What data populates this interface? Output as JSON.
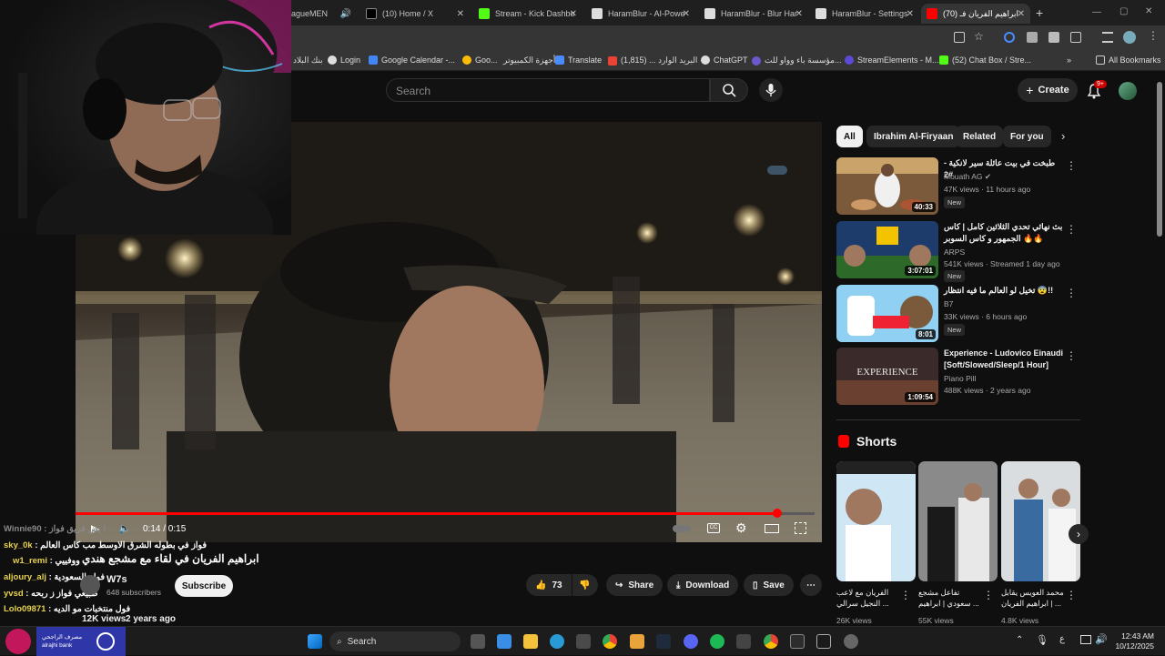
{
  "tabs": [
    {
      "label": "agueMEN"
    },
    {
      "label": "(10) Home / X"
    },
    {
      "label": "Stream - Kick Dashbo"
    },
    {
      "label": "HaramBlur - AI-Powe"
    },
    {
      "label": "HaramBlur - Blur Har"
    },
    {
      "label": "HaramBlur - Settings"
    },
    {
      "label": "(70) ابراهيم الفريان فـ"
    }
  ],
  "bookmarks": [
    {
      "label": "بنك البلاد"
    },
    {
      "label": "Login"
    },
    {
      "label": "Google Calendar -..."
    },
    {
      "label": "Goo..."
    },
    {
      "label": "أجهزة الكمبيوتر"
    },
    {
      "label": "Translate"
    },
    {
      "label": "البريد الوارد ... (1,815)"
    },
    {
      "label": "ChatGPT"
    },
    {
      "label": "مؤسسة باء وواو للت..."
    },
    {
      "label": "StreamElements - M..."
    },
    {
      "label": "(52) Chat Box / Stre..."
    },
    {
      "label": "All Bookmarks"
    }
  ],
  "header": {
    "search_placeholder": "Search",
    "create_label": "Create",
    "notif_count": "9+"
  },
  "player": {
    "time": "0:14 / 0:15",
    "progress": 0.95
  },
  "video": {
    "title": "ابراهيم الفريان في لقاء مع مشجع هندي",
    "channel": "W7s",
    "subscribers": "648 subscribers",
    "subscribe_label": "Subscribe",
    "likes": "73",
    "share_label": "Share",
    "download_label": "Download",
    "save_label": "Save",
    "views": "12K views",
    "age": "2 years ago"
  },
  "chat": [
    {
      "user": "Winnie90",
      "msg": "يض فريق فواز !"
    },
    {
      "user": "sky_0k",
      "msg": "فواز في بطوله الشرق الاوسط مب كاس العالم"
    },
    {
      "user": "w1_remi",
      "msg": "ووفييي"
    },
    {
      "user": "aljoury_alj",
      "msg": "فوله السعودية"
    },
    {
      "user": "yvsd",
      "msg": "طبيعي فواز ز ربحه"
    },
    {
      "user": "Lolo09871",
      "msg": "فول منتخبات مو الديه"
    }
  ],
  "filters": [
    {
      "label": "All"
    },
    {
      "label": "Ibrahim Al-Firyaan"
    },
    {
      "label": "Related"
    },
    {
      "label": "For you"
    }
  ],
  "recommended": [
    {
      "title": "طبخت في بيت عائلة سير لانكية - #2",
      "channel": "Mouath AG",
      "meta": "47K views · 11 hours ago",
      "duration": "40:33",
      "badge": "New"
    },
    {
      "title": "بث نهائي تحدي الثلاثين كامل | كاس الجمهور و كاس السوبر 🔥🔥",
      "channel": "ARPS",
      "meta": "541K views · Streamed 1 day ago",
      "duration": "3:07:01",
      "badge": "New"
    },
    {
      "title": "تخيل لو العالم ما فيه انتظار 😨!!",
      "channel": "B7",
      "meta": "33K views · 6 hours ago",
      "duration": "8:01",
      "badge": "New"
    },
    {
      "title": "Experience - Ludovico Einaudi [Soft/Slowed/Sleep/1 Hour]",
      "channel": "Piano Pill",
      "meta": "488K views · 2 years ago",
      "duration": "1:09:54",
      "badge": ""
    }
  ],
  "shorts": {
    "heading": "Shorts",
    "items": [
      {
        "title": "الفريان مع لاعب النجيل سرالي ...",
        "views": "26K views"
      },
      {
        "title": "تفاعل مشجع سعودي | ابراهيم ...",
        "views": "55K views"
      },
      {
        "title": "محمد العويس يقابل ابراهيم الفريان | ...",
        "views": "4.8K views"
      }
    ]
  },
  "taskbar": {
    "search_label": "Search",
    "time": "12:43 AM",
    "date": "10/12/2025",
    "bank_text_ar": "مصرف الراجحي",
    "bank_text_en": "alrajhi bank"
  }
}
